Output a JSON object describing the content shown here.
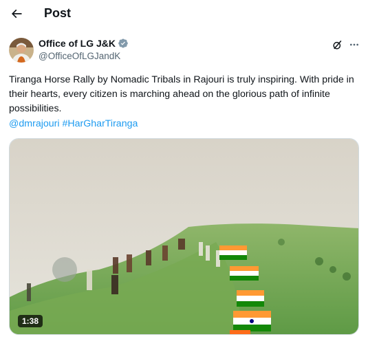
{
  "header": {
    "title": "Post",
    "back_icon": "arrow-left-icon"
  },
  "post": {
    "author": {
      "name": "Office of LG J&K",
      "handle": "@OfficeOfLGJandK",
      "verified_color": "#829aab"
    },
    "text": "Tiranga Horse Rally by Nomadic Tribals in Rajouri is truly inspiring. With pride in their hearts, every citizen is marching ahead on the glorious path of infinite possibilities.",
    "mention": "@dmrajouri",
    "hashtag": "#HarGharTiranga",
    "link_color": "#1d9bf0",
    "media": {
      "type": "video",
      "duration": "1:38"
    }
  },
  "actions": {
    "grok_icon": "grok-icon",
    "more_icon": "more-horizontal-icon"
  }
}
